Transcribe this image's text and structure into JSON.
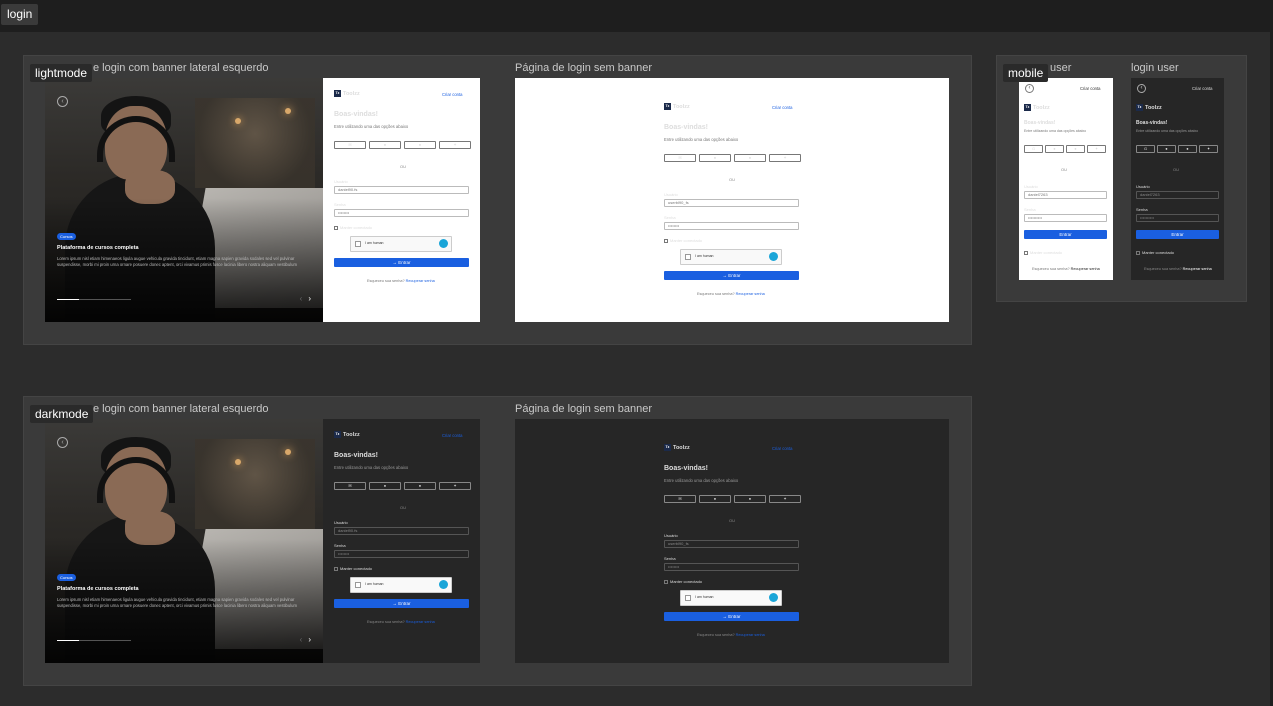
{
  "page_tab": "login",
  "sections": {
    "light": {
      "tag": "lightmode"
    },
    "dark": {
      "tag": "darkmode"
    },
    "mobile": {
      "tag": "mobile"
    }
  },
  "frames": {
    "banner_title": "Página de login com banner lateral esquerdo",
    "banner_title_visible": "e login com banner lateral esquerdo",
    "nobanner_title": "Página de login sem banner",
    "mobile_title_1": "user",
    "mobile_title_2": "login user"
  },
  "login": {
    "logo": "Toolzz",
    "logo_mark": "Tz",
    "create_account": "Criar conta",
    "welcome": "Boas-vindas!",
    "subtitle": "Entre utilizando uma das opções abaixo",
    "or": "OU",
    "user_label": "Usuário",
    "user_value": "daniel90.fs",
    "user_value_alt": "userbl90_fs",
    "pass_label": "Senha",
    "pass_value": "••••••••",
    "remember": "Manter conectado",
    "captcha": "I am human",
    "captcha_brand": "hCaptcha",
    "submit": "Entrar",
    "forgot": "Esqueceu sua senha?",
    "recover": "Recuperar senha",
    "social_icons": [
      "google-icon",
      "facebook-icon",
      "apple-icon",
      "twitter-icon"
    ]
  },
  "banner": {
    "badge": "Cursos",
    "title": "Plataforma de cursos completa",
    "description": "Lorem ipsum nisl etiam himenaeos ligula augue vehicula gravida tincidunt, etiam magna sapien gravida sodales sed vel pulvinar suspendisse, morbi mi proin urna ornare posuere donec aptent, orci vivamus primis fusce lacinia libero nostra aliquam vestibulum"
  },
  "mobile": {
    "user_value": "daniel7263",
    "pass_value": "••••••••••"
  },
  "colors": {
    "accent": "#1a5fe0",
    "canvas": "#1e1e1e",
    "section": "#3a3a3a"
  }
}
